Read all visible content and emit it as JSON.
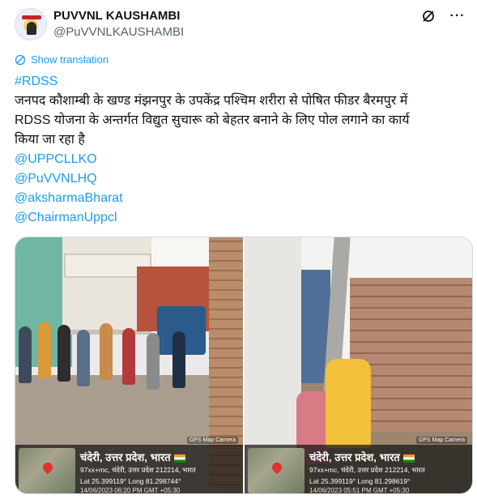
{
  "account": {
    "name": "PUVVNL KAUSHAMBI",
    "handle": "@PuVVNLKAUSHAMBI"
  },
  "actions": {
    "grok_icon": "slashed-circle-icon",
    "more_icon": "more-dots-icon",
    "more_label": "···"
  },
  "translate": {
    "label": "Show translation",
    "icon": "globe-icon"
  },
  "tweet": {
    "hashtag": "#RDSS",
    "body_lines": [
      "जनपद कौशाम्बी के खण्ड मंझनपुर के उपकेंद्र पश्चिम शरीरा से पोषित फीडर बैरमपुर में",
      "RDSS योजना के अन्तर्गत विद्युत सुचारू को बेहतर बनाने के लिए पोल लगाने का कार्य",
      "किया जा रहा है"
    ],
    "mentions": [
      "@UPPCLLKO",
      "@PuVVNLHQ",
      "@aksharmaBharat",
      "@ChairmanUppcl"
    ]
  },
  "photos": [
    {
      "gps_tag": "GPS Map Camera",
      "place": "चंदेरी, उत्तर प्रदेश, भारत",
      "address": "97xx+mc, चंदेरी, उत्तर प्रदेश 212214, भारत",
      "coords": "Lat 25.399119° Long 81.298744°",
      "time": "14/06/2023 06:20 PM GMT +05:30"
    },
    {
      "gps_tag": "GPS Map Camera",
      "place": "चंदेरी, उत्तर प्रदेश, भारत",
      "address": "97xx+mc, चंदेरी, उत्तर प्रदेश 212214, भारत",
      "coords": "Lat 25.399119° Long 81.298619°",
      "time": "14/06/2023 05:51 PM GMT +05:30"
    }
  ],
  "colors": {
    "link": "#1d9bf0",
    "text": "#0f1419",
    "muted": "#536471"
  }
}
